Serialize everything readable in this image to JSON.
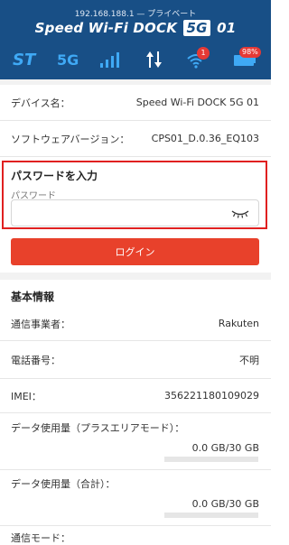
{
  "header": {
    "url": "192.168.188.1",
    "privacy": "— プライベート",
    "title_prefix": "Speed Wi-Fi DOCK",
    "title_badge": "5G",
    "title_suffix": "01"
  },
  "status": {
    "st": "ST",
    "network": "5G",
    "wifi_badge": "1",
    "battery": "98%",
    "icons": [
      "signal-icon",
      "updown-arrows-icon",
      "wifi-icon",
      "battery-icon"
    ]
  },
  "device_rows": [
    {
      "label": "デバイス名：",
      "value": "Speed Wi-Fi DOCK 5G 01"
    },
    {
      "label": "ソフトウェアバージョン：",
      "value": "CPS01_D.0.36_EQ103"
    }
  ],
  "login": {
    "title": "パスワードを入力",
    "field_label": "パスワード",
    "value": "",
    "button": "ログイン"
  },
  "basic_info": {
    "title": "基本情報",
    "rows": [
      {
        "label": "通信事業者：",
        "value": "Rakuten"
      },
      {
        "label": "電話番号：",
        "value": "不明"
      },
      {
        "label": "IMEI：",
        "value": "356221180109029"
      }
    ],
    "usage": [
      {
        "label": "データ使用量（プラスエリアモード）：",
        "value": "0.0 GB/30 GB",
        "fraction": 0.0
      },
      {
        "label": "データ使用量（合計）：",
        "value": "0.0 GB/30 GB",
        "fraction": 0.0
      }
    ],
    "mode_label": "通信モード："
  },
  "colors": {
    "header_bg": "#184f86",
    "accent": "#3fa9f5",
    "alert": "#e02020",
    "button": "#e8412b"
  }
}
